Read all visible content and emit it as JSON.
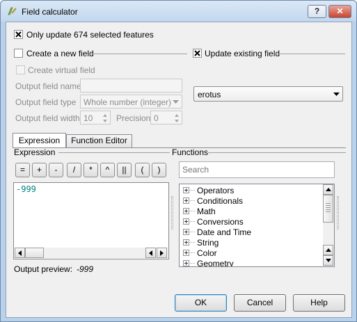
{
  "window": {
    "title": "Field calculator",
    "help_glyph": "?",
    "close_glyph": "✕",
    "icon": "field-calculator-icon"
  },
  "selection": {
    "only_selected_label": "Only update 674 selected features",
    "only_selected_checked": true
  },
  "create_field": {
    "label": "Create a new field",
    "checked": false,
    "virtual_label": "Create virtual field",
    "name_label": "Output field name",
    "name_value": "",
    "type_label": "Output field type",
    "type_value": "Whole number (integer)",
    "width_label": "Output field width",
    "width_value": "10",
    "precision_label": "Precision",
    "precision_value": "0"
  },
  "update_field": {
    "label": "Update existing field",
    "checked": true,
    "selected_field": "erotus"
  },
  "tabs": [
    {
      "label": "Expression",
      "active": true
    },
    {
      "label": "Function Editor",
      "active": false
    }
  ],
  "expression": {
    "section_label": "Expression",
    "operators": [
      "=",
      "+",
      "-",
      "/",
      "*",
      "^",
      "||",
      "(",
      ")"
    ],
    "text": "-999",
    "preview_label": "Output preview:",
    "preview_value": "-999"
  },
  "functions": {
    "section_label": "Functions",
    "search_placeholder": "Search",
    "items": [
      "Operators",
      "Conditionals",
      "Math",
      "Conversions",
      "Date and Time",
      "String",
      "Color",
      "Geometry"
    ]
  },
  "buttons": {
    "ok": "OK",
    "cancel": "Cancel",
    "help": "Help"
  },
  "colors": {
    "expression_text": "#008080",
    "title_bar": "#c2d7ee",
    "close_button": "#c9452f"
  }
}
